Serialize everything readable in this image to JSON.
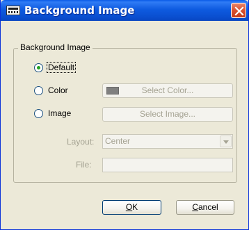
{
  "window": {
    "title": "Background Image",
    "icon": "app-icon",
    "close_icon": "close-icon"
  },
  "group": {
    "label": "Background Image"
  },
  "options": {
    "default_label": "Default",
    "color_label": "Color",
    "image_label": "Image",
    "selected": "Default"
  },
  "buttons": {
    "select_color": "Select Color...",
    "select_image": "Select Image...",
    "ok_accel": "O",
    "ok_rest": "K",
    "cancel_accel": "C",
    "cancel_rest": "ancel"
  },
  "layout_field": {
    "label": "Layout:",
    "value": "Center"
  },
  "file_field": {
    "label": "File:",
    "value": ""
  },
  "colors": {
    "titlebar": "#0a4fd0",
    "close": "#d9502f",
    "dialog_bg": "#ece9d8",
    "swatch": "#808080",
    "radio_dot": "#21a121"
  }
}
